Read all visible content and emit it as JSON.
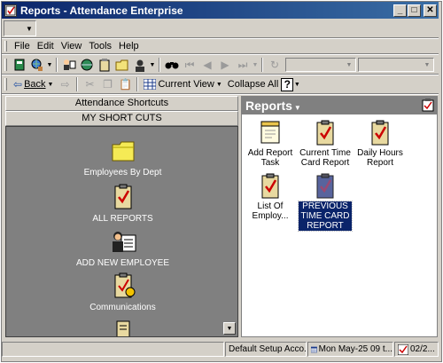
{
  "window": {
    "title": "Reports - Attendance Enterprise",
    "app_icon": "attendance-app-icon",
    "minimize_glyph": "_",
    "maximize_glyph": "□",
    "close_glyph": "✕"
  },
  "menu": {
    "items": [
      "File",
      "Edit",
      "View",
      "Tools",
      "Help"
    ]
  },
  "toolbar2": {
    "back_label": "Back",
    "current_view_label": "Current View",
    "collapse_all_label": "Collapse All",
    "help_glyph": "?"
  },
  "left_pane": {
    "header": "Attendance Shortcuts",
    "subheader": "MY SHORT CUTS",
    "shortcuts": [
      {
        "label": "Employees By Dept",
        "icon": "folder-icon"
      },
      {
        "label": "ALL REPORTS",
        "icon": "report-clipboard-icon"
      },
      {
        "label": "ADD NEW EMPLOYEE",
        "icon": "employee-card-icon"
      },
      {
        "label": "Communications",
        "icon": "communications-clipboard-icon"
      }
    ]
  },
  "right_pane": {
    "title": "Reports",
    "reports": [
      {
        "label_lines": [
          "Add Report",
          "Task"
        ],
        "icon": "add-report-task-icon"
      },
      {
        "label_lines": [
          "Current Time",
          "Card Report"
        ],
        "icon": "report-clipboard-icon"
      },
      {
        "label_lines": [
          "Daily Hours",
          "Report"
        ],
        "icon": "report-clipboard-icon"
      },
      {
        "label_lines": [
          "List Of",
          "Employ..."
        ],
        "icon": "report-clipboard-icon"
      },
      {
        "label_lines": [
          "PREVIOUS",
          "TIME CARD",
          "REPORT"
        ],
        "icon": "report-clipboard-icon",
        "selected": true
      }
    ]
  },
  "status": {
    "setup": "Default Setup Acco...",
    "date": "Mon May-25 09 t...",
    "short_date": "02/2..."
  },
  "colors": {
    "title_gradient_start": "#0a246a",
    "title_gradient_end": "#3a6ea5",
    "selection": "#0a246a",
    "shortcut_bg": "#808080"
  }
}
